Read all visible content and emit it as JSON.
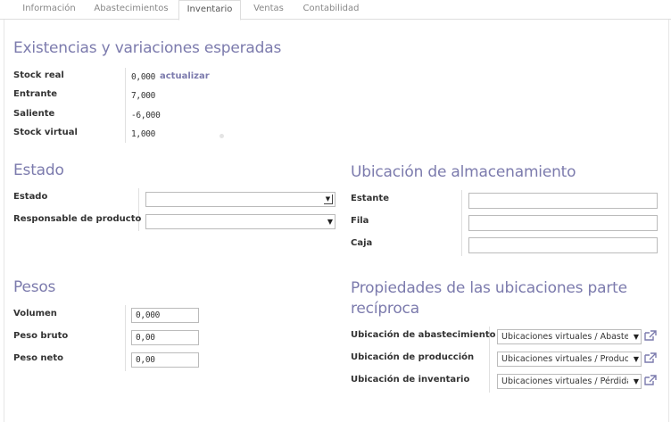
{
  "tabs": [
    "Información",
    "Abastecimientos",
    "Inventario",
    "Ventas",
    "Contabilidad"
  ],
  "stock": {
    "title": "Existencias y variaciones esperadas",
    "real_label": "Stock real",
    "real_value": "0,000",
    "update_link": "actualizar",
    "incoming_label": "Entrante",
    "incoming_value": "7,000",
    "outgoing_label": "Saliente",
    "outgoing_value": "-6,000",
    "virtual_label": "Stock virtual",
    "virtual_value": "1,000"
  },
  "estado": {
    "title": "Estado",
    "state_label": "Estado",
    "state_value": "",
    "responsible_label": "Responsable de producto",
    "responsible_value": ""
  },
  "storage": {
    "title": "Ubicación de almacenamiento",
    "shelf_label": "Estante",
    "shelf_value": "",
    "row_label": "Fila",
    "row_value": "",
    "box_label": "Caja",
    "box_value": ""
  },
  "weights": {
    "title": "Pesos",
    "volume_label": "Volumen",
    "volume_value": "0,000",
    "gross_label": "Peso bruto",
    "gross_value": "0,00",
    "net_label": "Peso neto",
    "net_value": "0,00"
  },
  "locations": {
    "title_line1": "Propiedades de las ubicaciones parte",
    "title_line2": "recíproca",
    "procurement_label": "Ubicación de abastecimiento",
    "procurement_value": "Ubicaciones virtuales / Abastecimientos",
    "production_label": "Ubicación de producción",
    "production_value": "Ubicaciones virtuales / Producción",
    "inventory_label": "Ubicación de inventario",
    "inventory_value": "Ubicaciones virtuales / Pérdidas de inventario"
  },
  "colors": {
    "accent": "#7c7bad",
    "link": "#7c7bad",
    "border": "#bbbbbb"
  },
  "icons": {
    "external_link": "external-link-icon",
    "dropdown": "chevron-down-icon"
  }
}
